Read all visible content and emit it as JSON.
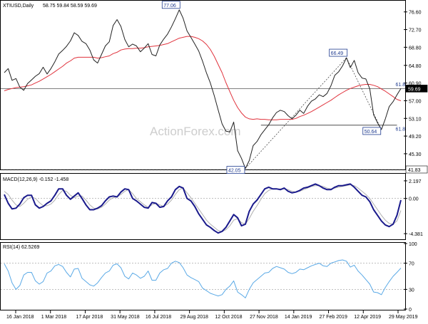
{
  "header": {
    "symbol": "XTIUSD,Daily",
    "ohlc": "58.75 59.84 58.59 59.69"
  },
  "watermark": "ActionForex.com",
  "colors": {
    "price": "#222222",
    "ma": "#e0323c",
    "macd": "#1a1a8c",
    "signal": "#b0b0b0",
    "rsi": "#5aa9e6",
    "label_box": "#1f3b8f",
    "current_price_bg": "#000000"
  },
  "chart_data": [
    {
      "type": "line",
      "panel": "price",
      "ylim": [
        41.83,
        78.6
      ],
      "y_ticks": [
        "76.60",
        "72.70",
        "68.80",
        "64.80",
        "60.90",
        "57.00",
        "53.10",
        "49.20",
        "45.30"
      ],
      "x_ticks": [
        "16 Jan 2018",
        "1 Mar 2018",
        "17 Apr 2018",
        "31 May 2018",
        "16 Jul 2018",
        "29 Aug 2018",
        "12 Oct 2018",
        "27 Nov 2018",
        "14 Jan 2019",
        "27 Feb 2019",
        "12 Apr 2019",
        "29 May 2019"
      ],
      "series": [
        {
          "values": [
            63.2,
            64.1,
            61.5,
            61.9,
            60.0,
            59.3,
            60.8,
            61.6,
            62.4,
            63.0,
            64.4,
            62.9,
            64.1,
            65.6,
            67.3,
            68.1,
            69.0,
            70.2,
            72.0,
            71.4,
            70.1,
            69.6,
            68.2,
            66.0,
            65.3,
            67.2,
            69.1,
            70.0,
            73.6,
            74.9,
            73.4,
            70.5,
            68.9,
            69.5,
            69.1,
            67.8,
            68.6,
            69.6,
            67.2,
            66.9,
            69.3,
            70.6,
            71.7,
            73.3,
            75.1,
            77.06,
            75.2,
            72.4,
            71.0,
            69.5,
            68.0,
            65.7,
            63.1,
            60.9,
            58.1,
            55.0,
            51.9,
            50.3,
            50.1,
            52.3,
            46.0,
            44.3,
            42.05,
            43.8,
            47.1,
            48.0,
            49.5,
            50.6,
            51.7,
            53.2,
            54.4,
            54.9,
            54.6,
            53.7,
            53.0,
            53.8,
            54.9,
            54.2,
            55.8,
            56.9,
            57.4,
            58.3,
            57.9,
            58.6,
            60.3,
            62.6,
            63.4,
            64.7,
            66.49,
            64.3,
            65.9,
            63.2,
            62.0,
            61.8,
            59.6,
            53.9,
            52.1,
            50.64,
            53.0,
            55.7,
            56.8,
            58.3,
            59.69
          ]
        },
        {
          "values": [
            59.2,
            59.5,
            59.7,
            59.9,
            60.0,
            60.1,
            60.3,
            60.5,
            60.9,
            61.3,
            61.8,
            62.3,
            62.8,
            63.4,
            64.0,
            64.6,
            65.3,
            65.8,
            66.4,
            66.6,
            66.6,
            66.6,
            66.6,
            66.6,
            66.4,
            66.5,
            66.7,
            66.9,
            67.4,
            67.7,
            68.2,
            68.4,
            68.5,
            68.5,
            68.6,
            68.6,
            68.7,
            68.9,
            69.0,
            69.1,
            69.2,
            69.4,
            69.6,
            70.0,
            70.4,
            70.8,
            71.0,
            71.2,
            71.2,
            71.0,
            70.7,
            70.2,
            69.4,
            68.3,
            66.8,
            65.0,
            63.2,
            61.0,
            59.0,
            57.1,
            55.5,
            54.3,
            53.4,
            53.0,
            52.9,
            53.0,
            52.9,
            52.9,
            52.8,
            52.8,
            52.8,
            52.9,
            52.9,
            52.9,
            52.9,
            53.1,
            53.5,
            53.8,
            54.2,
            54.6,
            55.1,
            55.6,
            56.1,
            56.6,
            57.1,
            57.7,
            58.3,
            58.8,
            59.3,
            59.7,
            60.0,
            60.3,
            60.5,
            60.6,
            60.6,
            60.4,
            60.1,
            59.6,
            59.1,
            58.5,
            57.9,
            57.3,
            57.0
          ]
        }
      ],
      "annotations": [
        {
          "label": "77.06",
          "x_index": 45,
          "y": 77.06
        },
        {
          "label": "42.05",
          "x_index": 62,
          "y": 42.05
        },
        {
          "label": "66.49",
          "x_index": 88,
          "y": 66.49
        },
        {
          "label": "50.64",
          "x_index": 97,
          "y": 50.64
        },
        {
          "label": "61.8",
          "x_index": 101,
          "y": 61.0
        },
        {
          "label": "61.8",
          "x_index": 101,
          "y": 51.2
        }
      ],
      "levels": [
        {
          "label": "59.69",
          "y": 59.69
        },
        {
          "label": "41.83",
          "y": 41.83
        }
      ]
    },
    {
      "type": "line",
      "panel": "macd",
      "title": "MACD(12,26,9) -0.152 -1.458",
      "ylim": [
        -4.9,
        2.9
      ],
      "y_ticks": [
        "2.197",
        "0.00",
        "-4.381"
      ],
      "series": [
        {
          "values": [
            0.5,
            -0.6,
            -1.3,
            -1.2,
            -0.7,
            0.1,
            0.4,
            0.4,
            -0.8,
            -1.2,
            -1.0,
            -0.6,
            -0.3,
            0.4,
            1.2,
            1.2,
            0.4,
            -0.1,
            0.3,
            0.7,
            0.0,
            -0.8,
            -1.4,
            -1.4,
            -1.2,
            -0.9,
            -0.3,
            0.2,
            0.3,
            0.2,
            0.8,
            1.2,
            1.1,
            0.0,
            -0.3,
            -0.7,
            -1.1,
            -1.2,
            -0.5,
            -0.6,
            -1.1,
            -1.0,
            -0.3,
            0.2,
            1.1,
            1.5,
            1.3,
            0.0,
            -0.3,
            -1.0,
            -1.9,
            -2.6,
            -3.3,
            -3.6,
            -4.0,
            -4.3,
            -4.1,
            -3.6,
            -2.8,
            -2.0,
            -2.4,
            -3.4,
            -3.2,
            -1.6,
            -0.7,
            -0.2,
            0.5,
            1.2,
            1.4,
            1.2,
            1.2,
            1.1,
            1.3,
            0.9,
            0.7,
            0.8,
            1.0,
            1.3,
            1.4,
            1.6,
            1.8,
            1.6,
            1.3,
            1.1,
            1.1,
            1.4,
            1.6,
            1.6,
            1.7,
            1.8,
            1.4,
            0.9,
            0.4,
            0.2,
            -0.4,
            -1.4,
            -2.1,
            -2.8,
            -3.3,
            -3.5,
            -3.2,
            -2.1,
            -0.2
          ]
        },
        {
          "values": [
            0.9,
            0.5,
            -0.2,
            -0.8,
            -1.0,
            -0.6,
            -0.1,
            0.2,
            0.0,
            -0.5,
            -0.9,
            -0.9,
            -0.7,
            -0.2,
            0.5,
            1.0,
            0.9,
            0.4,
            0.1,
            0.3,
            0.3,
            -0.2,
            -0.8,
            -1.2,
            -1.3,
            -1.1,
            -0.7,
            -0.2,
            0.1,
            0.2,
            0.5,
            0.9,
            1.1,
            0.6,
            0.0,
            -0.4,
            -0.8,
            -1.1,
            -0.8,
            -0.6,
            -0.8,
            -1.0,
            -0.7,
            -0.2,
            0.5,
            1.1,
            1.3,
            0.7,
            0.1,
            -0.6,
            -1.3,
            -2.0,
            -2.7,
            -3.2,
            -3.6,
            -4.0,
            -4.1,
            -3.9,
            -3.4,
            -2.7,
            -2.5,
            -3.0,
            -3.2,
            -2.5,
            -1.6,
            -0.9,
            -0.1,
            0.6,
            1.0,
            1.2,
            1.2,
            1.2,
            1.2,
            1.1,
            0.9,
            0.8,
            0.9,
            1.1,
            1.3,
            1.5,
            1.6,
            1.6,
            1.5,
            1.3,
            1.2,
            1.3,
            1.4,
            1.5,
            1.6,
            1.7,
            1.6,
            1.3,
            0.9,
            0.5,
            0.0,
            -0.7,
            -1.4,
            -2.1,
            -2.7,
            -3.1,
            -3.2,
            -2.8,
            -1.5
          ]
        }
      ]
    },
    {
      "type": "line",
      "panel": "rsi",
      "title": "RSI(14) 62.5269",
      "ylim": [
        0,
        100
      ],
      "y_ticks": [
        "100",
        "70",
        "30",
        "0"
      ],
      "series": [
        {
          "values": [
            69,
            58,
            40,
            30,
            36,
            52,
            56,
            56,
            43,
            38,
            42,
            55,
            58,
            66,
            68,
            65,
            56,
            49,
            61,
            62,
            47,
            42,
            37,
            35,
            40,
            48,
            55,
            58,
            67,
            69,
            63,
            50,
            46,
            55,
            52,
            47,
            50,
            58,
            44,
            44,
            55,
            60,
            62,
            70,
            73,
            71,
            63,
            52,
            48,
            45,
            42,
            32,
            28,
            24,
            22,
            20,
            22,
            30,
            35,
            43,
            26,
            22,
            17,
            30,
            40,
            45,
            50,
            55,
            56,
            62,
            65,
            63,
            61,
            56,
            54,
            56,
            61,
            60,
            63,
            66,
            68,
            70,
            66,
            65,
            70,
            72,
            74,
            75,
            73,
            64,
            67,
            58,
            52,
            45,
            38,
            26,
            25,
            22,
            33,
            42,
            50,
            56,
            62.5
          ]
        }
      ],
      "levels": [
        70,
        30
      ]
    }
  ]
}
